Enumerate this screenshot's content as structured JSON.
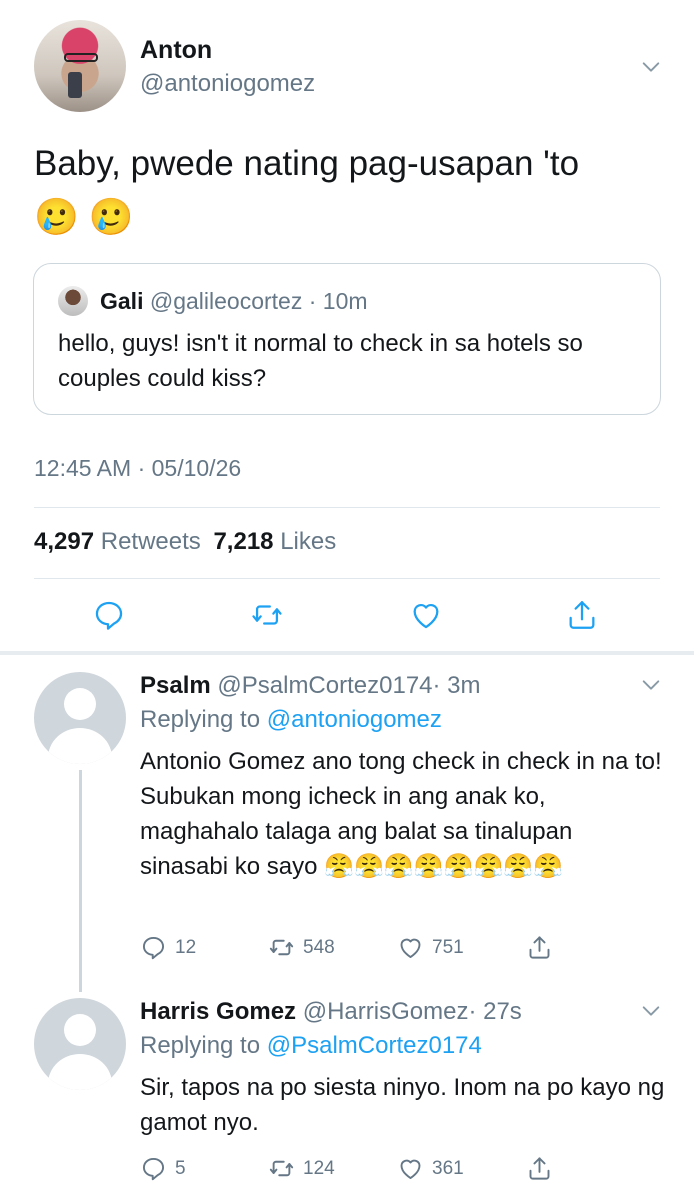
{
  "main_tweet": {
    "name": "Anton",
    "handle": "@antoniogomez",
    "text": "Baby, pwede nating pag-usapan 'to",
    "emojis": [
      "🥲",
      "🥲"
    ],
    "quote": {
      "name": "Gali",
      "handle": "@galileocortez",
      "time": "· 10m",
      "text": "hello, guys! isn't it normal to check in sa hotels so couples could kiss?"
    },
    "timestamp": "12:45 AM · 05/10/26",
    "retweets_count": "4,297",
    "retweets_label": "Retweets",
    "likes_count": "7,218",
    "likes_label": "Likes"
  },
  "replies": [
    {
      "name": "Psalm",
      "handle": "@PsalmCortez0174",
      "time": "· 3m",
      "replying_prefix": "Replying to",
      "replying_to": "@antoniogomez",
      "text": "Antonio Gomez ano tong check in check in na to! Subukan mong icheck in ang anak ko, maghahalo talaga ang balat sa tinalupan sinasabi ko sayo 😤😤😤😤😤😤😤😤",
      "replies": "12",
      "retweets": "548",
      "likes": "751"
    },
    {
      "name": "Harris Gomez",
      "handle": "@HarrisGomez",
      "time": "· 27s",
      "replying_prefix": "Replying to",
      "replying_to": "@PsalmCortez0174",
      "text": "Sir, tapos na po siesta ninyo. Inom na po kayo ng gamot nyo.",
      "replies": "5",
      "retweets": "124",
      "likes": "361"
    }
  ],
  "colors": {
    "accent": "#1da1f2",
    "secondary_text": "#657786",
    "border": "#e1e8ed"
  },
  "icons": [
    "chevron-down-icon",
    "reply-icon",
    "retweet-icon",
    "like-icon",
    "share-icon"
  ]
}
